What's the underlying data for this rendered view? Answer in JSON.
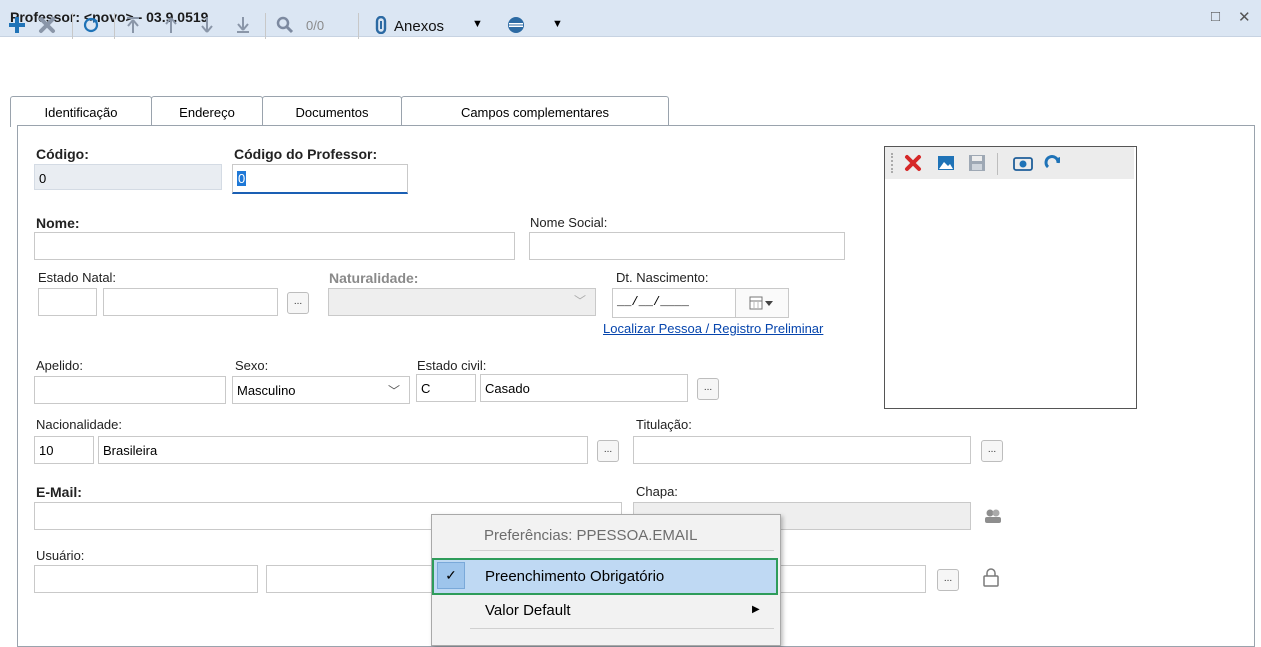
{
  "window": {
    "title": "Professor: <novo> - 03.9.0519",
    "restore_icon": "□",
    "close_icon": "✕"
  },
  "toolbar": {
    "pager": "0/0",
    "anexos_label": "Anexos"
  },
  "tabs": [
    "Identificação",
    "Endereço",
    "Documentos",
    "Campos complementares"
  ],
  "form": {
    "codigo_label": "Código:",
    "codigo_value": "0",
    "codigo_prof_label": "Código do Professor:",
    "codigo_prof_value": "0",
    "nome_label": "Nome:",
    "nome_social_label": "Nome Social:",
    "estado_natal_label": "Estado Natal:",
    "naturalidade_label": "Naturalidade:",
    "dt_nasc_label": "Dt. Nascimento:",
    "dt_nasc_value": "__/__/____",
    "localizar_link": "Localizar Pessoa / Registro Preliminar",
    "apelido_label": "Apelido:",
    "sexo_label": "Sexo:",
    "sexo_value": "Masculino",
    "estado_civil_label": "Estado civil:",
    "estado_civil_code": "C",
    "estado_civil_value": "Casado",
    "nacionalidade_label": "Nacionalidade:",
    "nacionalidade_code": "10",
    "nacionalidade_value": "Brasileira",
    "titulacao_label": "Titulação:",
    "email_label": "E-Mail:",
    "chapa_label": "Chapa:",
    "usuario_label": "Usuário:",
    "dots": "..."
  },
  "context_menu": {
    "header": "Preferências: PPESSOA.EMAIL",
    "item_required": "Preenchimento Obrigatório",
    "item_default": "Valor Default",
    "check": "✓",
    "arrow": "▶"
  }
}
